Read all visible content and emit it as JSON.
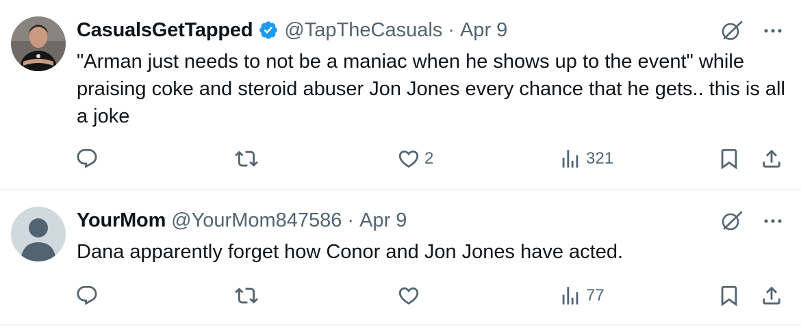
{
  "colors": {
    "text_primary": "#0f1419",
    "text_secondary": "#536471",
    "verified": "#1d9bf0",
    "divider": "#eff3f4"
  },
  "tweets": [
    {
      "display_name": "CasualsGetTapped",
      "verified": true,
      "handle": "@TapTheCasuals",
      "separator": "·",
      "date": "Apr 9",
      "text": "\"Arman just needs to not be a maniac when he shows up to the event\" while praising coke and steroid abuser Jon Jones every chance that he gets.. this is all a joke",
      "replies": "",
      "retweets": "",
      "likes": "2",
      "views": "321",
      "avatar": "profile-photo"
    },
    {
      "display_name": "YourMom",
      "verified": false,
      "handle": "@YourMom847586",
      "separator": "·",
      "date": "Apr 9",
      "text": "Dana apparently forget how Conor and Jon Jones have acted.",
      "replies": "",
      "retweets": "",
      "likes": "",
      "views": "77",
      "avatar": "default-avatar"
    }
  ],
  "icons": {
    "reply": "reply-icon",
    "retweet": "retweet-icon",
    "like": "heart-icon",
    "views": "views-icon",
    "bookmark": "bookmark-icon",
    "share": "share-icon",
    "grok": "grok-icon",
    "more": "more-icon",
    "verified": "verified-badge-icon"
  }
}
